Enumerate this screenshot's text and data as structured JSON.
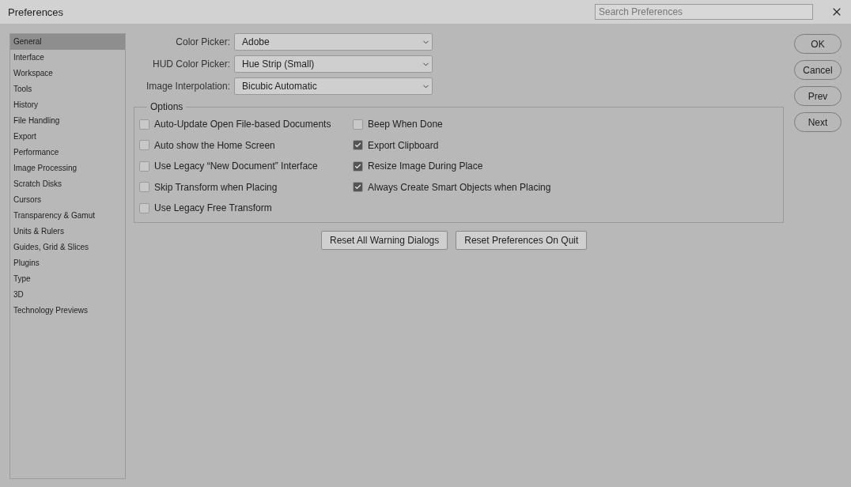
{
  "window": {
    "title": "Preferences"
  },
  "search": {
    "placeholder": "Search Preferences"
  },
  "sidebar": {
    "items": [
      {
        "label": "General",
        "selected": true
      },
      {
        "label": "Interface",
        "selected": false
      },
      {
        "label": "Workspace",
        "selected": false
      },
      {
        "label": "Tools",
        "selected": false
      },
      {
        "label": "History",
        "selected": false
      },
      {
        "label": "File Handling",
        "selected": false
      },
      {
        "label": "Export",
        "selected": false
      },
      {
        "label": "Performance",
        "selected": false
      },
      {
        "label": "Image Processing",
        "selected": false
      },
      {
        "label": "Scratch Disks",
        "selected": false
      },
      {
        "label": "Cursors",
        "selected": false
      },
      {
        "label": "Transparency & Gamut",
        "selected": false
      },
      {
        "label": "Units & Rulers",
        "selected": false
      },
      {
        "label": "Guides, Grid & Slices",
        "selected": false
      },
      {
        "label": "Plugins",
        "selected": false
      },
      {
        "label": "Type",
        "selected": false
      },
      {
        "label": "3D",
        "selected": false
      },
      {
        "label": "Technology Previews",
        "selected": false
      }
    ]
  },
  "fields": [
    {
      "label": "Color Picker:",
      "value": "Adobe"
    },
    {
      "label": "HUD Color Picker:",
      "value": "Hue Strip (Small)"
    },
    {
      "label": "Image Interpolation:",
      "value": "Bicubic Automatic"
    }
  ],
  "options": {
    "legend": "Options",
    "items": [
      {
        "label": "Auto-Update Open File-based Documents",
        "checked": false
      },
      {
        "label": "Auto show the Home Screen",
        "checked": false
      },
      {
        "label": "Use Legacy “New Document” Interface",
        "checked": false
      },
      {
        "label": "Skip Transform when Placing",
        "checked": false
      },
      {
        "label": "Use Legacy Free Transform",
        "checked": false
      },
      {
        "label": "Beep When Done",
        "checked": false
      },
      {
        "label": "Export Clipboard",
        "checked": true
      },
      {
        "label": "Resize Image During Place",
        "checked": true
      },
      {
        "label": "Always Create Smart Objects when Placing",
        "checked": true
      }
    ]
  },
  "reset_buttons": [
    "Reset All Warning Dialogs",
    "Reset Preferences On Quit"
  ],
  "buttons": [
    "OK",
    "Cancel",
    "Prev",
    "Next"
  ]
}
